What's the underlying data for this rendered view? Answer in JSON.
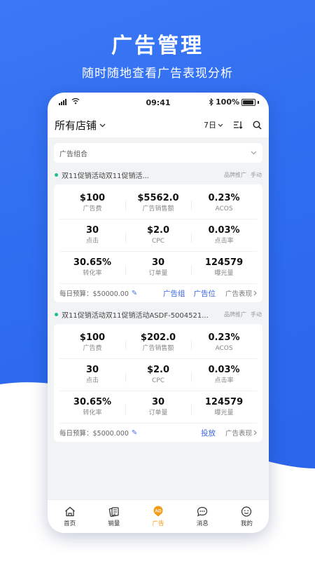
{
  "promo": {
    "title": "广告管理",
    "subtitle": "随时随地查看广告表现分析"
  },
  "status_bar": {
    "time": "09:41",
    "battery": "100%"
  },
  "header": {
    "store": "所有店铺",
    "period": "7日"
  },
  "combo_filter": "广告组合",
  "campaigns": [
    {
      "name": "双11促销活动双11促销活...",
      "tag_brand": "品牌推广",
      "tag_mode": "手动",
      "metrics": [
        {
          "value": "$100",
          "label": "广告费"
        },
        {
          "value": "$5562.0",
          "label": "广告销售额"
        },
        {
          "value": "0.23%",
          "label": "ACOS"
        },
        {
          "value": "30",
          "label": "点击"
        },
        {
          "value": "$2.0",
          "label": "CPC"
        },
        {
          "value": "0.03%",
          "label": "点击率"
        },
        {
          "value": "30.65%",
          "label": "转化率"
        },
        {
          "value": "30",
          "label": "订单量"
        },
        {
          "value": "124579",
          "label": "曝光量"
        }
      ],
      "budget": "每日预算：$50000.00",
      "link1": "广告组",
      "link2": "广告位",
      "perf": "广告表现"
    },
    {
      "name": "双11促销活动双11促销活动ASDF-5004521...",
      "tag_brand": "品牌推广",
      "tag_mode": "手动",
      "metrics": [
        {
          "value": "$100",
          "label": "广告费"
        },
        {
          "value": "$202.0",
          "label": "广告销售额"
        },
        {
          "value": "0.23%",
          "label": "ACOS"
        },
        {
          "value": "30",
          "label": "点击"
        },
        {
          "value": "$2.0",
          "label": "CPC"
        },
        {
          "value": "0.03%",
          "label": "点击率"
        },
        {
          "value": "30.65%",
          "label": "转化率"
        },
        {
          "value": "30",
          "label": "订单量"
        },
        {
          "value": "124579",
          "label": "曝光量"
        }
      ],
      "budget": "每日预算：$5000.000",
      "link1": "投放",
      "perf": "广告表现"
    }
  ],
  "tabs": [
    {
      "label": "首页",
      "icon": "home-icon"
    },
    {
      "label": "销量",
      "icon": "sales-icon"
    },
    {
      "label": "广告",
      "icon": "ad-icon",
      "active": true
    },
    {
      "label": "消息",
      "icon": "message-icon"
    },
    {
      "label": "我的",
      "icon": "profile-icon"
    }
  ],
  "colors": {
    "brand_blue": "#2e6cf0",
    "accent_orange": "#f39a17",
    "active_green": "#20c08a",
    "link_blue": "#3c67e3"
  }
}
